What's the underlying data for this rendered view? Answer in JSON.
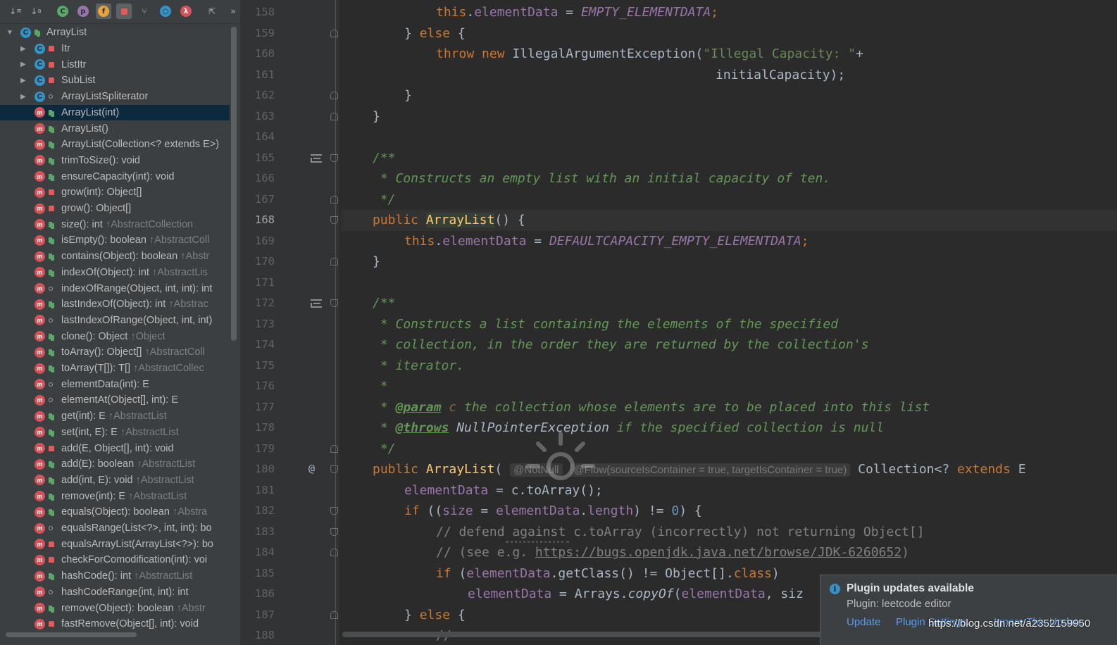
{
  "toolbar": {
    "buttons": [
      "sort-visibility",
      "sort-alpha",
      "class-filter",
      "property-filter",
      "field-filter",
      "non-public-filter",
      "inherited-filter",
      "anonymous-filter",
      "lambda-filter",
      "autoscroll",
      "more"
    ],
    "more_label": "»"
  },
  "tree": {
    "root": "ArrayList",
    "nested": [
      "Itr",
      "ListItr",
      "SubList",
      "ArrayListSpliterator"
    ],
    "members": [
      {
        "name": "ArrayList(int)",
        "sup": ""
      },
      {
        "name": "ArrayList()",
        "sup": ""
      },
      {
        "name": "ArrayList(Collection<? extends E>)",
        "sup": ""
      },
      {
        "name": "trimToSize(): void",
        "sup": ""
      },
      {
        "name": "ensureCapacity(int): void",
        "sup": ""
      },
      {
        "name": "grow(int): Object[]",
        "sup": ""
      },
      {
        "name": "grow(): Object[]",
        "sup": ""
      },
      {
        "name": "size(): int",
        "sup": "↑AbstractCollection"
      },
      {
        "name": "isEmpty(): boolean",
        "sup": "↑AbstractColl"
      },
      {
        "name": "contains(Object): boolean",
        "sup": "↑Abstr"
      },
      {
        "name": "indexOf(Object): int",
        "sup": "↑AbstractLis"
      },
      {
        "name": "indexOfRange(Object, int, int): int",
        "sup": ""
      },
      {
        "name": "lastIndexOf(Object): int",
        "sup": "↑Abstrac"
      },
      {
        "name": "lastIndexOfRange(Object, int, int)",
        "sup": ""
      },
      {
        "name": "clone(): Object",
        "sup": "↑Object"
      },
      {
        "name": "toArray(): Object[]",
        "sup": "↑AbstractColl"
      },
      {
        "name": "toArray(T[]): T[]",
        "sup": "↑AbstractCollec"
      },
      {
        "name": "elementData(int): E",
        "sup": ""
      },
      {
        "name": "elementAt(Object[], int): E",
        "sup": ""
      },
      {
        "name": "get(int): E",
        "sup": "↑AbstractList"
      },
      {
        "name": "set(int, E): E",
        "sup": "↑AbstractList"
      },
      {
        "name": "add(E, Object[], int): void",
        "sup": ""
      },
      {
        "name": "add(E): boolean",
        "sup": "↑AbstractList"
      },
      {
        "name": "add(int, E): void",
        "sup": "↑AbstractList"
      },
      {
        "name": "remove(int): E",
        "sup": "↑AbstractList"
      },
      {
        "name": "equals(Object): boolean",
        "sup": "↑Abstra"
      },
      {
        "name": "equalsRange(List<?>, int, int): bo",
        "sup": ""
      },
      {
        "name": "equalsArrayList(ArrayList<?>): bo",
        "sup": ""
      },
      {
        "name": "checkForComodification(int): voi",
        "sup": ""
      },
      {
        "name": "hashCode(): int",
        "sup": "↑AbstractList"
      },
      {
        "name": "hashCodeRange(int, int): int",
        "sup": ""
      },
      {
        "name": "remove(Object): boolean",
        "sup": "↑Abstr"
      },
      {
        "name": "fastRemove(Object[], int): void",
        "sup": ""
      }
    ]
  },
  "editor": {
    "line_numbers": [
      "158",
      "159",
      "160",
      "161",
      "162",
      "163",
      "164",
      "165",
      "166",
      "167",
      "168",
      "169",
      "170",
      "171",
      "172",
      "173",
      "174",
      "175",
      "176",
      "177",
      "178",
      "179",
      "180",
      "181",
      "182",
      "183",
      "184",
      "185",
      "186",
      "187",
      "188"
    ],
    "current_line": "168",
    "code": {
      "l158_this": "this",
      "l158_rest": ".",
      "l158_fld": "elementData",
      "l158_eq": " = ",
      "l158_const": "EMPTY_ELEMENTDATA",
      "l158_semi": ";",
      "l159_a": "} ",
      "l159_kw": "else",
      "l159_b": " {",
      "l160_kw1": "throw",
      "l160_sp": " ",
      "l160_kw2": "new",
      "l160_cls": " IllegalArgumentException(",
      "l160_str": "\"Illegal Capacity: \"",
      "l160_plus": "+",
      "l161": "initialCapacity);",
      "l162": "}",
      "l163": "}",
      "l165": "/**",
      "l166": " * Constructs an empty list with an initial capacity of ten.",
      "l167": " */",
      "l168_kw": "public",
      "l168_sp": " ",
      "l168_name": "ArrayList",
      "l168_rest": "() {",
      "l169_this": "this",
      "l169_dot": ".",
      "l169_fld": "elementData",
      "l169_eq": " = ",
      "l169_const": "DEFAULTCAPACITY_EMPTY_ELEMENTDATA",
      "l169_semi": ";",
      "l170": "}",
      "l172": "/**",
      "l173": " * Constructs a list containing the elements of the specified",
      "l174": " * collection, in the order they are returned by the collection's",
      "l175": " * iterator.",
      "l176": " *",
      "l177_a": " * ",
      "l177_tag": "@param",
      "l177_sp": " ",
      "l177_val": "c",
      "l177_rest": " the collection whose elements are to be placed into this list",
      "l178_a": " * ",
      "l178_tag": "@throws",
      "l178_sp": " ",
      "l178_ref": "NullPointerException",
      "l178_rest": " if the specified collection is null",
      "l179": " */",
      "l180_kw": "public",
      "l180_sp": " ",
      "l180_name": "ArrayList",
      "l180_p": "( ",
      "l180_hint1": "@NotNull",
      "l180_hint2": "@Flow(sourceIsContainer = true, targetIsContainer = true)",
      "l180_type": " Collection<? ",
      "l180_ext": "extends",
      "l180_e": " E",
      "l181_fld": "elementData",
      "l181_rest": " = c.toArray();",
      "l182_kw": "if",
      "l182_a": " ((",
      "l182_f1": "size",
      "l182_b": " = ",
      "l182_f2": "elementData",
      "l182_c": ".",
      "l182_f3": "length",
      "l182_d": ") != ",
      "l182_num": "0",
      "l182_e": ") {",
      "l183": "// defend against c.toArray (incorrectly) not returning Object[]",
      "l184_a": "// (see e.g. ",
      "l184_link": "https://bugs.openjdk.java.net/browse/JDK-6260652",
      "l184_b": ")",
      "l185_kw": "if",
      "l185_a": " (",
      "l185_f": "elementData",
      "l185_b": ".getClass() != Object[].",
      "l185_cls": "class",
      "l185_c": ")",
      "l186_f": "elementData",
      "l186_a": " = Arrays.",
      "l186_m": "copyOf",
      "l186_b": "(",
      "l186_f2": "elementData",
      "l186_c": ", siz",
      "l187_a": "} ",
      "l187_kw": "else",
      "l187_b": " {",
      "l188": "//"
    }
  },
  "notification": {
    "title": "Plugin updates available",
    "body": "Plugin: leetcode editor",
    "update_link": "Update",
    "settings_link": "Plugin Settings...",
    "ignore_link": "Ignore This Update"
  },
  "watermark": "https://blog.csdn.net/a2352159950",
  "colors": {
    "keyword": "#cc7832",
    "field": "#9876aa",
    "string": "#6a8759",
    "doc_comment": "#629755",
    "comment": "#808080",
    "method_highlight": "#ffc66d",
    "link": "#589df6"
  }
}
